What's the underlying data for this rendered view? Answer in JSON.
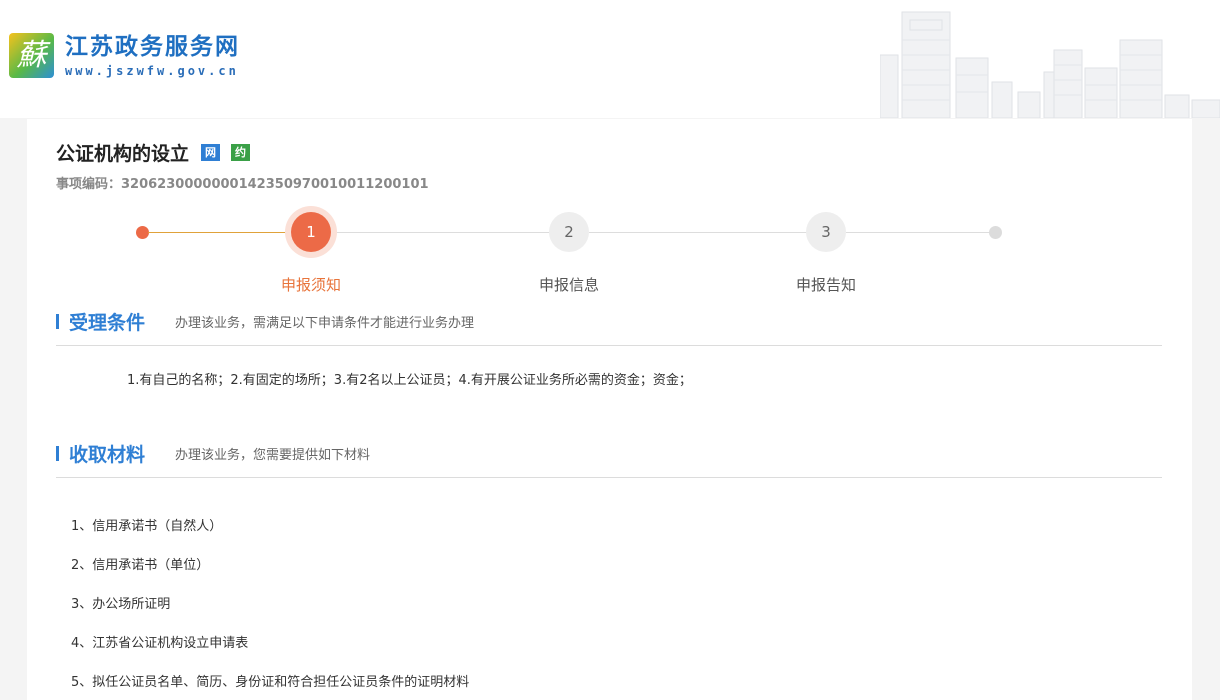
{
  "header": {
    "logo_glyph": "蘇",
    "site_title": "江苏政务服务网",
    "site_url": "www.jszwfw.gov.cn"
  },
  "item": {
    "title": "公证机构的设立",
    "tags": [
      "网",
      "约"
    ],
    "code": "事项编码：320623000000014235097001001120010​1"
  },
  "stepper": {
    "steps": [
      {
        "number": "1",
        "label": "申报须知",
        "state": "active"
      },
      {
        "number": "2",
        "label": "申报信息",
        "state": "idle"
      },
      {
        "number": "3",
        "label": "申报告知",
        "state": "idle"
      }
    ]
  },
  "conditions": {
    "title": "受理条件",
    "description": "办理该业务，需满足以下申请条件才能进行业务办理",
    "text": "1.有自己的名称；2.有固定的场所；3.有2名以上公证员；4.有开展公证业务所必需的资金；资金；"
  },
  "materials": {
    "title": "收取材料",
    "description": "办理该业务，您需要提供如下材料",
    "items": [
      "1、信用承诺书（自然人）",
      "2、信用承诺书（单位）",
      "3、办公场所证明",
      "4、江苏省公证机构设立申请表",
      "5、拟任公证员名单、简历、身份证和符合担任公证员条件的证明材料"
    ]
  },
  "colors": {
    "accent_blue": "#2f7fd4",
    "step_active": "#ec6a47",
    "step_line_done": "#e0a23a"
  }
}
